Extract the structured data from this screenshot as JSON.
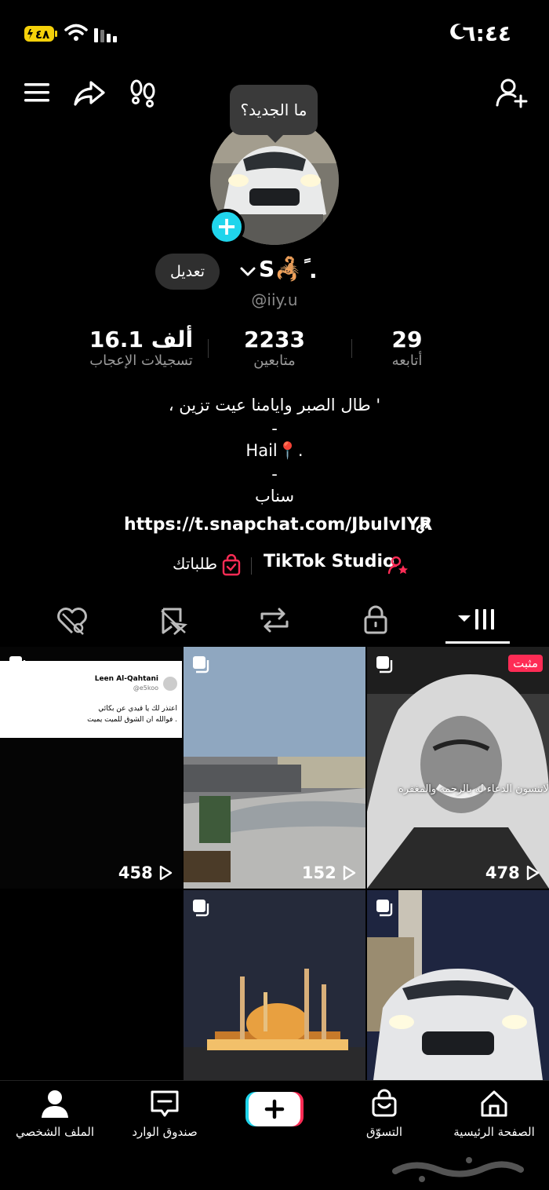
{
  "status_bar": {
    "time": "٦:٤٤",
    "battery": "٤٨"
  },
  "tooltip": "ما الجديد؟",
  "profile": {
    "edit_label": "تعديل",
    "display_name": "S🦂ً",
    "handle": "@iiy.u",
    "stats": [
      {
        "value": "29",
        "label": "أتابعه"
      },
      {
        "value": "2233",
        "label": "متابعين"
      },
      {
        "value": "16.1 ألف",
        "label": "تسجيلات الإعجاب"
      }
    ],
    "bio_lines": [
      "، طال الصبر وايامنا عيت تزين '",
      "-",
      "Hail📍.",
      "-",
      "سناب"
    ],
    "link": "https://t.snapchat.com/JbuIvIYR",
    "studio_label": "TikTok Studio",
    "orders_label": "طلباتك"
  },
  "tabs": [
    {
      "icon": "grid-icon",
      "selected": true
    },
    {
      "icon": "lock-icon",
      "selected": false
    },
    {
      "icon": "repost-icon",
      "selected": false
    },
    {
      "icon": "favorites-icon",
      "selected": false
    },
    {
      "icon": "liked-icon",
      "selected": false
    }
  ],
  "videos": [
    {
      "views": "478",
      "pinned": "مثبت",
      "caption": "لاتنسون الدعاء له بالرحمه والمغفره"
    },
    {
      "views": "152"
    },
    {
      "views": "458",
      "tweet_name": "Leen Al-Qahtani",
      "tweet_handle": "@e5koo",
      "tweet_line1": "اعتذر لك يا قيدي عن بكائي",
      "tweet_line2": "فوالله ان الشوق للميت يميت ."
    },
    {
      "views": ""
    },
    {
      "views": ""
    }
  ],
  "bottom_nav": {
    "home": "الصفحة الرئيسية",
    "shop": "التسوّق",
    "inbox": "صندوق الوارد",
    "profile": "الملف الشخصي"
  },
  "colors": {
    "accent_cyan": "#20d5ec",
    "accent_red": "#fe2c55",
    "background": "#000000"
  }
}
